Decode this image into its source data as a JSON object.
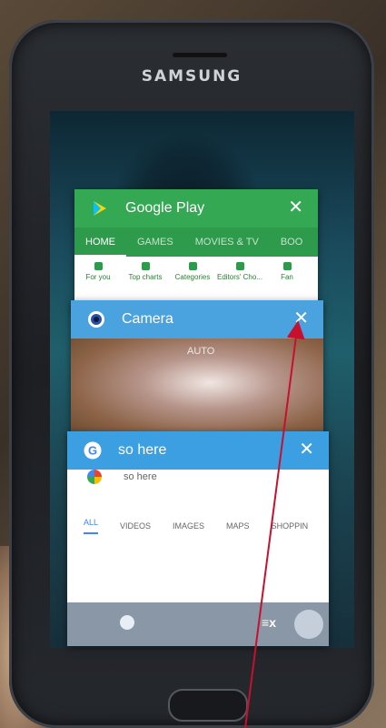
{
  "device": {
    "brand": "SAMSUNG"
  },
  "recent_apps": {
    "google_play": {
      "title": "Google Play",
      "close": "✕",
      "tabs": [
        "HOME",
        "GAMES",
        "MOVIES & TV",
        "BOO"
      ],
      "categories": [
        "For you",
        "Top charts",
        "Categories",
        "Editors' Cho...",
        "Fan"
      ]
    },
    "camera": {
      "title": "Camera",
      "close": "✕",
      "preview_text": "AUTO"
    },
    "so_here": {
      "title": "so here",
      "close": "✕",
      "search_query": "so here",
      "tabs": [
        "ALL",
        "VIDEOS",
        "IMAGES",
        "MAPS",
        "SHOPPIN"
      ],
      "bottom_bar_icon": "≡x"
    }
  },
  "colors": {
    "google_play_header": "#34a853",
    "camera_header": "#4aa3df",
    "so_here_header": "#3b9fe2",
    "annotation_arrow": "#c8102e"
  },
  "annotation": {
    "type": "arrow",
    "target": "camera-close-button"
  }
}
